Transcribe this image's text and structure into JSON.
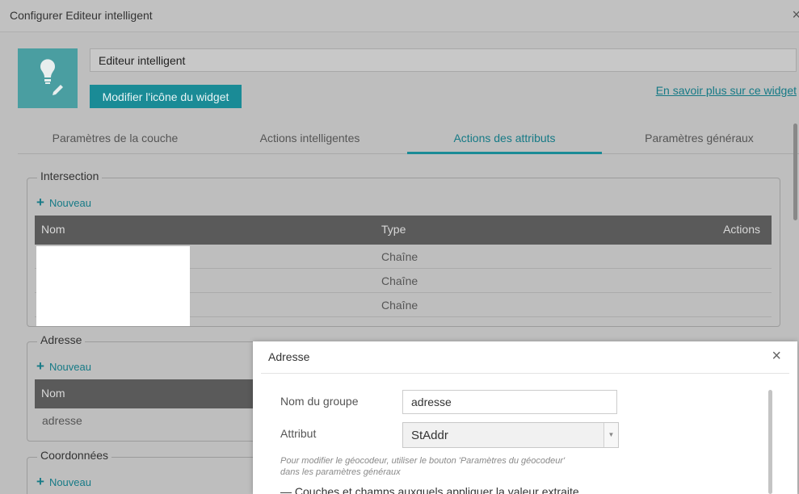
{
  "window": {
    "title": "Configurer Editeur intelligent",
    "close_glyph": "×"
  },
  "widget": {
    "icon": "lightbulb-pencil-icon",
    "name_value": "Editeur intelligent",
    "change_icon_label": "Modifier l'icône du widget",
    "learn_more_label": "En savoir plus sur ce widget"
  },
  "tabs": [
    {
      "label": "Paramètres de la couche"
    },
    {
      "label": "Actions intelligentes"
    },
    {
      "label": "Actions des attributs"
    },
    {
      "label": "Paramètres généraux"
    }
  ],
  "groups": {
    "intersection": {
      "legend": "Intersection",
      "new_label": "Nouveau",
      "columns": {
        "name": "Nom",
        "type": "Type",
        "actions": "Actions"
      },
      "rows": [
        {
          "type": "Chaîne"
        },
        {
          "type": "Chaîne"
        },
        {
          "type": "Chaîne"
        }
      ]
    },
    "address": {
      "legend": "Adresse",
      "new_label": "Nouveau",
      "columns": {
        "name": "Nom"
      },
      "rows": [
        {
          "name": "adresse"
        }
      ]
    },
    "coordinates": {
      "legend": "Coordonnées",
      "new_label": "Nouveau"
    }
  },
  "dialog": {
    "title": "Adresse",
    "close_glyph": "×",
    "group_name_label": "Nom du groupe",
    "group_name_value": "adresse",
    "attribute_label": "Attribut",
    "attribute_value": "StAddr",
    "hint_line1": "Pour modifier le géocodeur, utiliser le bouton 'Paramètres du géocodeur'",
    "hint_line2": "dans les paramètres généraux",
    "partial_legend": "Couches et champs auxquels appliquer la valeur extraite"
  },
  "colors": {
    "accent": "#1a8b96",
    "table_header": "#5a5a5a"
  }
}
